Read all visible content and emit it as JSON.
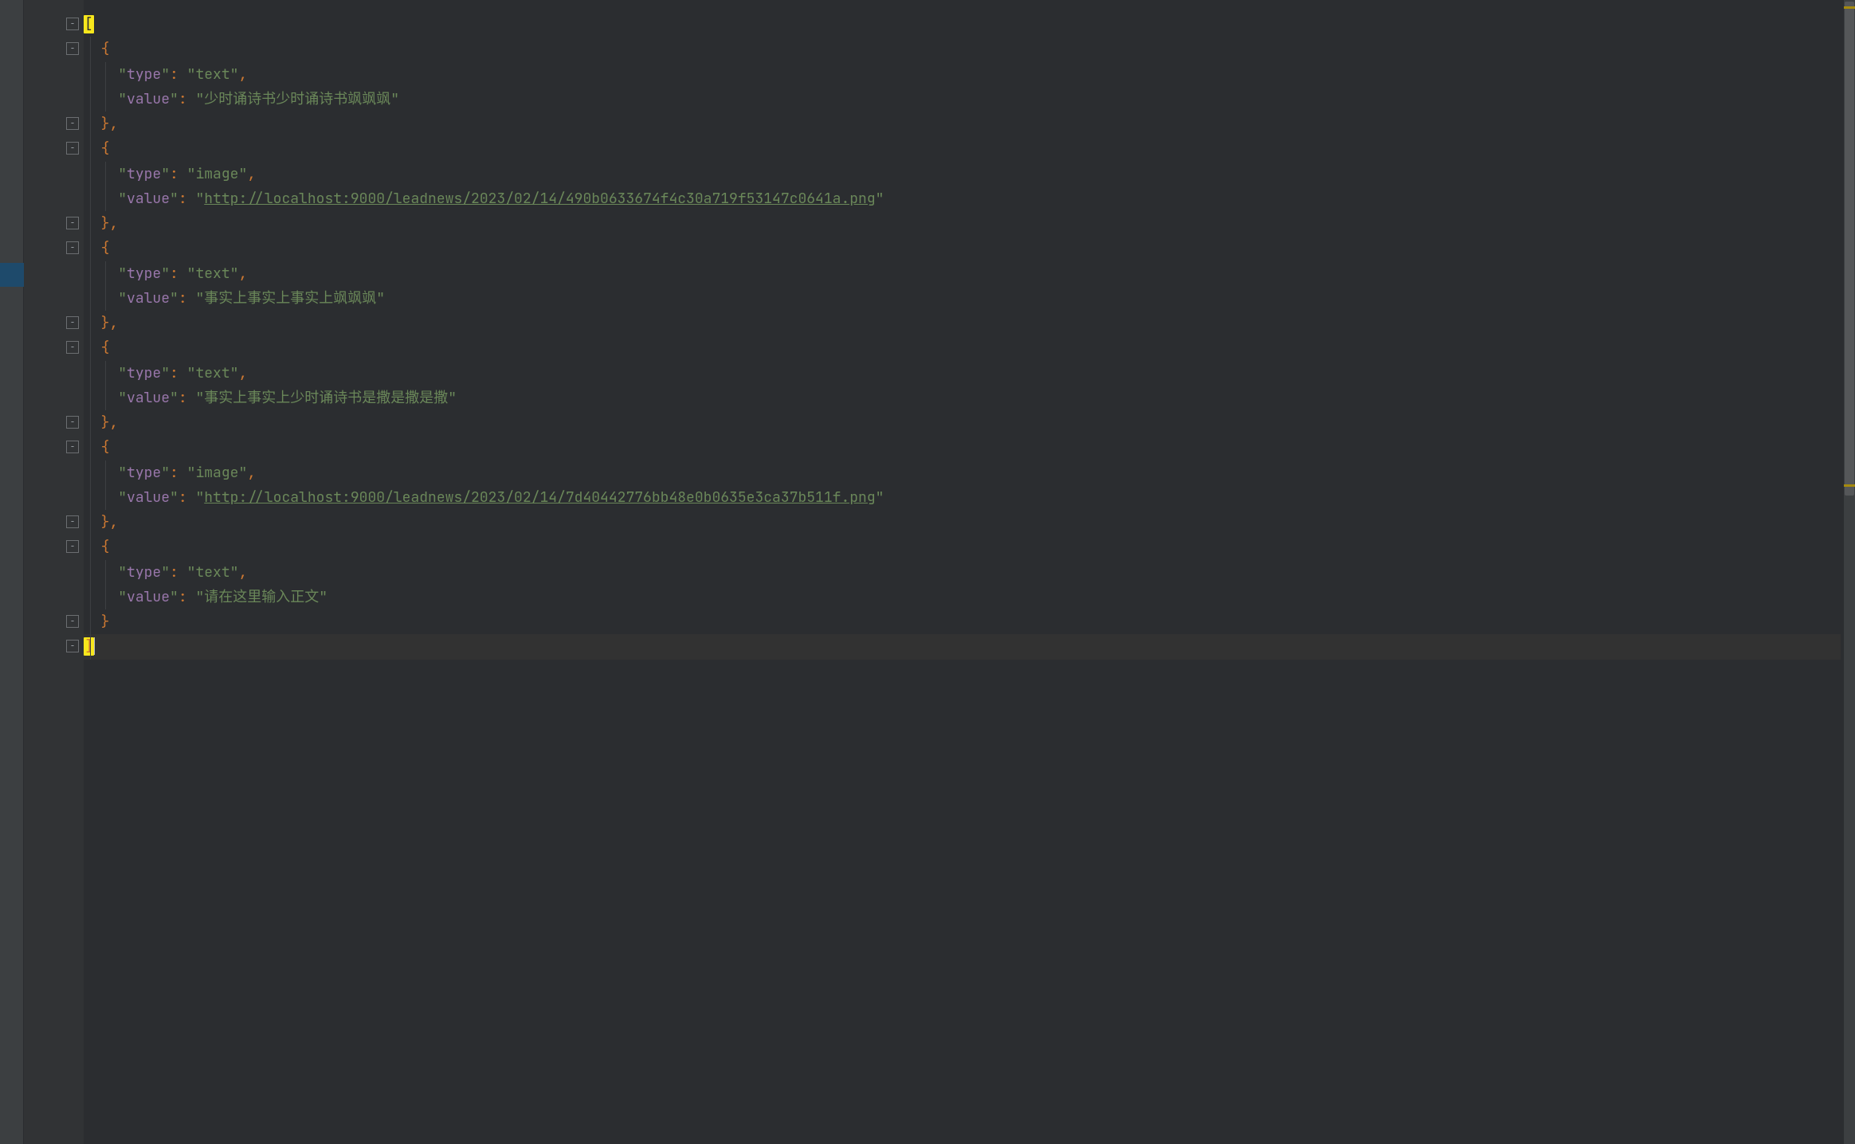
{
  "colors": {
    "background": "#2b2d30",
    "gutter": "#313335",
    "key": "#9876aa",
    "string": "#6a8759",
    "punct": "#cc7832",
    "highlight_bracket_bg": "#f8e71c"
  },
  "json_content": {
    "lines": [
      {
        "type": "open-array",
        "text": "["
      },
      {
        "type": "open-obj",
        "text": "  {"
      },
      {
        "type": "kv",
        "key": "type",
        "value": "text",
        "indent": "    "
      },
      {
        "type": "kv",
        "key": "value",
        "value": "少时诵诗书少时诵诗书飒飒飒",
        "indent": "    ",
        "trailing_comma": false
      },
      {
        "type": "close-obj",
        "text": "  },"
      },
      {
        "type": "open-obj",
        "text": "  {"
      },
      {
        "type": "kv",
        "key": "type",
        "value": "image",
        "indent": "    "
      },
      {
        "type": "kv-link",
        "key": "value",
        "value": "http://localhost:9000/leadnews/2023/02/14/490b0633674f4c30a719f53147c0641a.png",
        "indent": "    "
      },
      {
        "type": "close-obj",
        "text": "  },"
      },
      {
        "type": "open-obj",
        "text": "  {"
      },
      {
        "type": "kv",
        "key": "type",
        "value": "text",
        "indent": "    "
      },
      {
        "type": "kv",
        "key": "value",
        "value": "事实上事实上事实上飒飒飒",
        "indent": "    "
      },
      {
        "type": "close-obj",
        "text": "  },"
      },
      {
        "type": "open-obj",
        "text": "  {"
      },
      {
        "type": "kv",
        "key": "type",
        "value": "text",
        "indent": "    "
      },
      {
        "type": "kv",
        "key": "value",
        "value": "事实上事实上少时诵诗书是撒是撒是撒",
        "indent": "    "
      },
      {
        "type": "close-obj",
        "text": "  },"
      },
      {
        "type": "open-obj",
        "text": "  {"
      },
      {
        "type": "kv",
        "key": "type",
        "value": "image",
        "indent": "    "
      },
      {
        "type": "kv-link",
        "key": "value",
        "value": "http://localhost:9000/leadnews/2023/02/14/7d40442776bb48e0b0635e3ca37b511f.png",
        "indent": "    "
      },
      {
        "type": "close-obj",
        "text": "  },"
      },
      {
        "type": "open-obj",
        "text": "  {"
      },
      {
        "type": "kv",
        "key": "type",
        "value": "text",
        "indent": "    "
      },
      {
        "type": "kv",
        "key": "value",
        "value": "请在这里输入正文",
        "indent": "    "
      },
      {
        "type": "close-obj-last",
        "text": "  }"
      },
      {
        "type": "close-array",
        "text": "]"
      }
    ]
  },
  "fold_icons_at_index": [
    0,
    1,
    4,
    5,
    8,
    9,
    12,
    13,
    16,
    17,
    20,
    21,
    24,
    25
  ]
}
